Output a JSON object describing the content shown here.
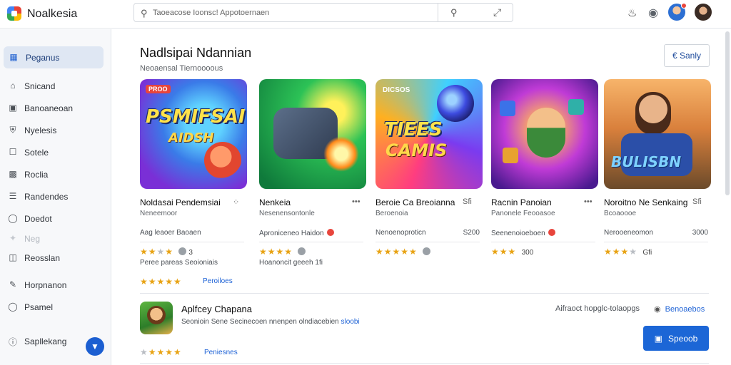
{
  "app": {
    "title": "Noalkesia"
  },
  "search": {
    "placeholder": "Taoeacose Ioonsc! Appotoernaen"
  },
  "header_icons": [
    "bell-icon",
    "settings-icon"
  ],
  "sidebar": {
    "items": [
      {
        "label": "Peganus",
        "icon": "grid-icon",
        "active": true
      },
      {
        "label": "Snicand",
        "icon": "home-icon"
      },
      {
        "label": "Banoaneoan",
        "icon": "apps-icon"
      },
      {
        "label": "Nyelesis",
        "icon": "shield-icon"
      },
      {
        "label": "Sotele",
        "icon": "box-icon"
      },
      {
        "label": "Roclia",
        "icon": "image-icon"
      },
      {
        "label": "Randendes",
        "icon": "list-icon"
      },
      {
        "label": "Doedot",
        "icon": "chat-icon"
      },
      {
        "label": "Neg",
        "icon": "sparkle-icon",
        "muted": true
      },
      {
        "label": "Reosslan",
        "icon": "folder-icon"
      },
      {
        "label": "Horpnanon",
        "icon": "edit-icon"
      },
      {
        "label": "Psamel",
        "icon": "tag-icon"
      },
      {
        "label": "Sapllekang",
        "icon": "info-icon"
      }
    ]
  },
  "section": {
    "title": "Nadlsipai Ndannian",
    "subtitle": "Neoaensal Tiernoooous",
    "see_all": "€ Sanly"
  },
  "cards": [
    {
      "art_badge": "PROO",
      "art_title": "PSMIFSAI",
      "art_sub": "AIDSH",
      "title": "Noldasai Pendemsiai",
      "more": "⁘",
      "developer": "Neneemoor",
      "meta": "Aag leaoer Baoaen",
      "meta_r": "",
      "rating": "3",
      "stars": 2,
      "foot": "Peree pareas Seoioniais",
      "foot_stars": 5,
      "link": "Peroiloes"
    },
    {
      "art_badge": "",
      "art_title": "",
      "art_sub": "",
      "title": "Nenkeia",
      "more": "•••",
      "developer": "Nesenensontonle",
      "meta": "Aproniceneo Haidon",
      "meta_r": "",
      "rating": "",
      "stars": 4,
      "foot": "Hoanoncit geeeh 1fi",
      "foot_stars": 0,
      "link": ""
    },
    {
      "art_badge": "DICSOS",
      "art_title": "TIEES",
      "art_sub": "CAMIS",
      "title": "Beroie Ca Breoianna",
      "more": "Sfi",
      "developer": "Beroenoia",
      "meta": "Nenoenoproticn",
      "meta_r": "S200",
      "rating": "",
      "stars": 5,
      "foot": "",
      "foot_stars": 0,
      "link": ""
    },
    {
      "art_badge": "",
      "art_title": "",
      "art_sub": "",
      "title": "Racnin Panoian",
      "more": "•••",
      "developer": "Panonele Feooasoe",
      "meta": "Seenenoioeboen",
      "meta_r": "",
      "rating": "300",
      "stars": 3,
      "foot": "",
      "foot_stars": 0,
      "link": ""
    },
    {
      "art_badge": "",
      "art_title": "",
      "art_sub": "BULISBN",
      "title": "Noroitno Ne Senkaing",
      "more": "Sfi",
      "developer": "Bcoaoooe",
      "meta": "Nerooeneomon",
      "meta_r": "3000",
      "rating": "Gfi",
      "stars": 3,
      "foot": "",
      "foot_stars": 0,
      "link": ""
    }
  ],
  "list_item": {
    "title": "Aplfcey Chapana",
    "desc_pre": "Seonioin Sene  Secinecoen  nnenpen  olndiacebien",
    "desc_hl": "sloobi",
    "right_text": "Aifraoct hopglc-tolaopgs",
    "right_link": "Benoaebos",
    "stars": 4,
    "link": "Peniesnes",
    "button": "Speoob"
  },
  "colors": {
    "accent": "#1c66d6",
    "star": "#e8a314",
    "sidebar_active": "#dfe7f3"
  }
}
